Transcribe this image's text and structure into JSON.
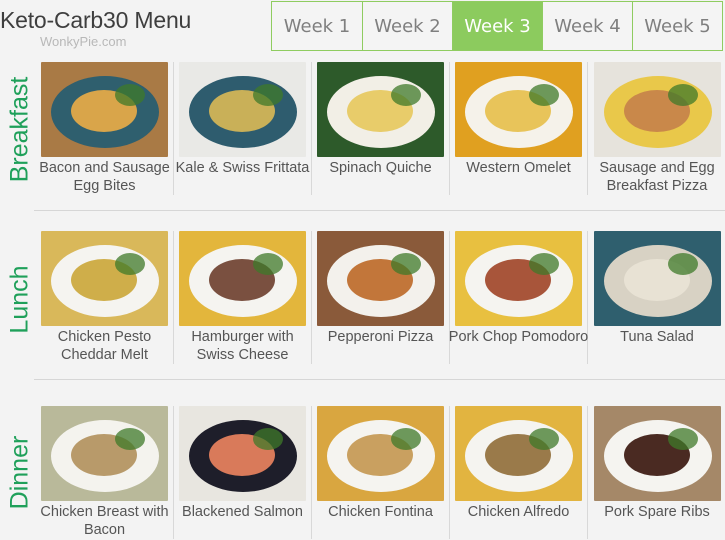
{
  "header": {
    "title": "Keto-Carb30 Menu",
    "subtitle": "WonkyPie.com"
  },
  "tabs": [
    {
      "label": "Week 1",
      "active": false
    },
    {
      "label": "Week 2",
      "active": false
    },
    {
      "label": "Week 3",
      "active": true
    },
    {
      "label": "Week 4",
      "active": false
    },
    {
      "label": "Week 5",
      "active": false
    }
  ],
  "colors": {
    "accent_green": "#8ccb5e",
    "section_label_green": "#1fa05a",
    "background": "#f3f3f3"
  },
  "sections": [
    {
      "label": "Breakfast",
      "items": [
        {
          "name": "Bacon and Sausage Egg Bites",
          "photo_bg": "#a97a45",
          "plate": "#2f5f6e",
          "food": "#d9a54a"
        },
        {
          "name": "Kale & Swiss Frittata",
          "photo_bg": "#e9e9e6",
          "plate": "#2e5c6e",
          "food": "#c9b058"
        },
        {
          "name": "Spinach Quiche",
          "photo_bg": "#2d5a2a",
          "plate": "#f2efe6",
          "food": "#e8cc6a"
        },
        {
          "name": "Western Omelet",
          "photo_bg": "#e0a020",
          "plate": "#f5f2ea",
          "food": "#e8c45a"
        },
        {
          "name": "Sausage and Egg Breakfast Pizza",
          "photo_bg": "#e6e3dc",
          "plate": "#e9c84a",
          "food": "#c9884a"
        }
      ]
    },
    {
      "label": "Lunch",
      "items": [
        {
          "name": "Chicken Pesto Cheddar Melt",
          "photo_bg": "#d9b85a",
          "plate": "#f5f4f0",
          "food": "#cfae4a"
        },
        {
          "name": "Hamburger with Swiss Cheese",
          "photo_bg": "#e3b63c",
          "plate": "#f5f4f0",
          "food": "#7a5040"
        },
        {
          "name": "Pepperoni Pizza",
          "photo_bg": "#8a5a3a",
          "plate": "#f3f1ec",
          "food": "#c2763a"
        },
        {
          "name": "Pork Chop Pomodoro",
          "photo_bg": "#e8c040",
          "plate": "#f5f4f0",
          "food": "#a8553a"
        },
        {
          "name": "Tuna Salad",
          "photo_bg": "#2f5f6e",
          "plate": "#d8d2c4",
          "food": "#e8e2d4"
        }
      ]
    },
    {
      "label": "Dinner",
      "items": [
        {
          "name": "Chicken Breast with Bacon",
          "photo_bg": "#b9b99a",
          "plate": "#f4f3ee",
          "food": "#b89a6a"
        },
        {
          "name": "Blackened Salmon",
          "photo_bg": "#e8e6e0",
          "plate": "#1e1e2a",
          "food": "#d97a5a"
        },
        {
          "name": "Chicken Fontina",
          "photo_bg": "#d9a640",
          "plate": "#f5f4f0",
          "food": "#c9a060"
        },
        {
          "name": "Chicken Alfredo",
          "photo_bg": "#e2b440",
          "plate": "#f5f4f0",
          "food": "#9a7a4a"
        },
        {
          "name": "Pork Spare Ribs",
          "photo_bg": "#a58868",
          "plate": "#f5f4f0",
          "food": "#4a2a22"
        }
      ]
    }
  ]
}
